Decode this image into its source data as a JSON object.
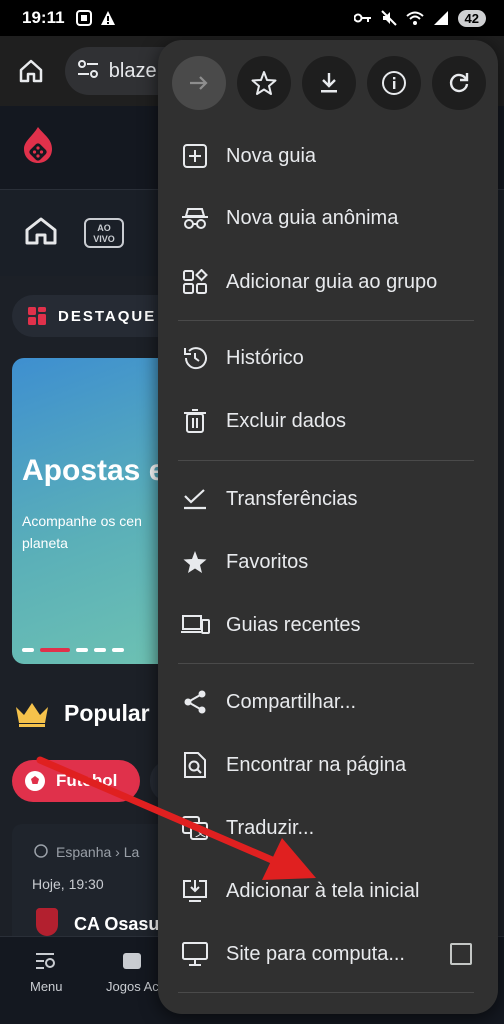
{
  "status_bar": {
    "time": "19:11",
    "battery": "42"
  },
  "toolbar": {
    "url": "blaze."
  },
  "site": {
    "destaques_label": "DESTAQUE",
    "aovivo_line1": "AO",
    "aovivo_line2": "VIVO",
    "banner_title": "Apostas e",
    "banner_subtitle": "Acompanhe os cen planeta",
    "popular_label": "Popular",
    "futebol_label": "Futebol",
    "match_league": "Espanha › La",
    "match_time": "Hoje, 19:30",
    "match_team": "CA Osasun",
    "bottom_nav": [
      "Menu",
      "Jogos Ac"
    ],
    "accent_color": "#e0314b"
  },
  "menu": {
    "actions": [
      "forward-icon",
      "star-icon",
      "download-icon",
      "info-icon",
      "reload-icon"
    ],
    "items": [
      {
        "label": "Nova guia",
        "icon": "new-tab-icon"
      },
      {
        "label": "Nova guia anônima",
        "icon": "incognito-icon"
      },
      {
        "label": "Adicionar guia ao grupo",
        "icon": "tab-group-icon"
      },
      {
        "label": "Histórico",
        "icon": "history-icon"
      },
      {
        "label": "Excluir dados",
        "icon": "trash-icon"
      },
      {
        "label": "Transferências",
        "icon": "downloads-check-icon"
      },
      {
        "label": "Favoritos",
        "icon": "bookmark-star-icon"
      },
      {
        "label": "Guias recentes",
        "icon": "recent-tabs-icon"
      },
      {
        "label": "Compartilhar...",
        "icon": "share-icon"
      },
      {
        "label": "Encontrar na página",
        "icon": "find-in-page-icon"
      },
      {
        "label": "Traduzir...",
        "icon": "translate-icon"
      },
      {
        "label": "Adicionar à tela inicial",
        "icon": "add-to-home-icon"
      },
      {
        "label": "Site para computa...",
        "icon": "desktop-icon"
      }
    ]
  },
  "annotation": {
    "color": "#e02020"
  }
}
